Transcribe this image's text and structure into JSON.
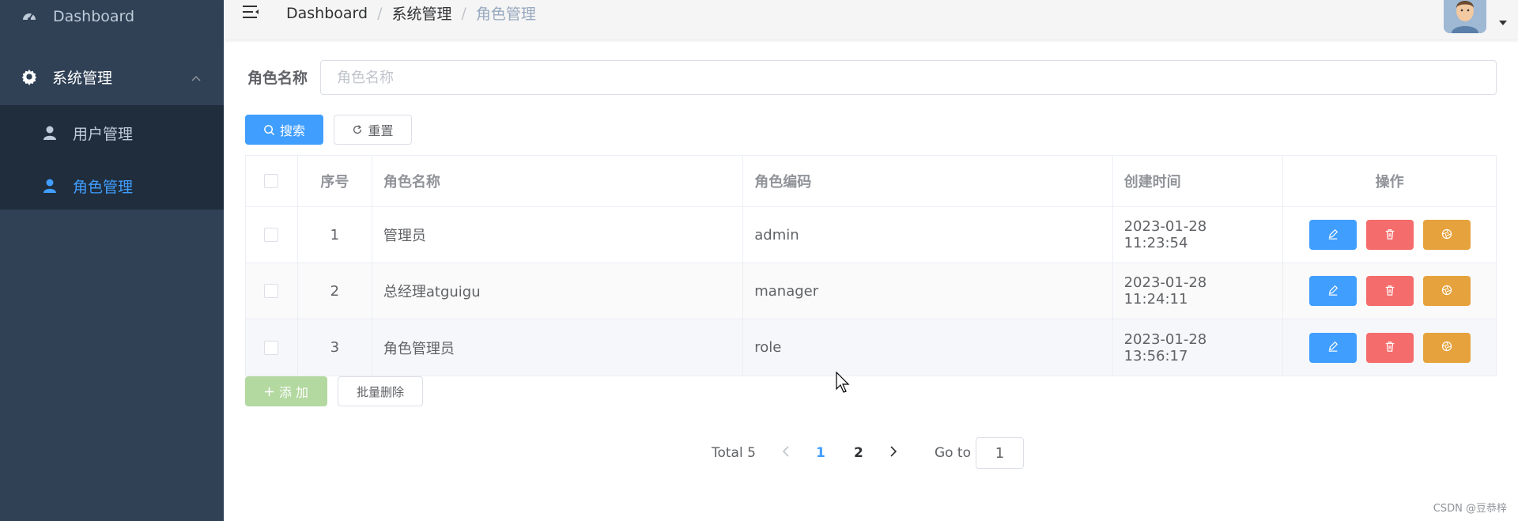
{
  "sidebar": {
    "dashboard": "Dashboard",
    "system": "系统管理",
    "user_mgmt": "用户管理",
    "role_mgmt": "角色管理"
  },
  "navbar": {
    "breadcrumb": [
      "Dashboard",
      "系统管理",
      "角色管理"
    ]
  },
  "search": {
    "label": "角色名称",
    "placeholder": "角色名称",
    "search_button": "搜索",
    "reset_button": "重置"
  },
  "table": {
    "headers": [
      "序号",
      "角色名称",
      "角色编码",
      "创建时间",
      "操作"
    ],
    "rows": [
      {
        "index": "1",
        "name": "管理员",
        "code": "admin",
        "created": "2023-01-28 11:23:54"
      },
      {
        "index": "2",
        "name": "总经理atguigu",
        "code": "manager",
        "created": "2023-01-28 11:24:11"
      },
      {
        "index": "3",
        "name": "角色管理员",
        "code": "role",
        "created": "2023-01-28 13:56:17"
      }
    ]
  },
  "actions": {
    "add": "添 加",
    "batch_delete": "批量删除"
  },
  "pagination": {
    "total": "Total 5",
    "pages": [
      "1",
      "2"
    ],
    "current": "1",
    "goto_label": "Go to",
    "goto_value": "1"
  },
  "watermark": "CSDN @豆恭梓",
  "colors": {
    "sidebar_bg": "#304156",
    "primary": "#409eff",
    "danger": "#f56c6c",
    "warning": "#e6a23c",
    "success_light": "#b3d8a0"
  }
}
